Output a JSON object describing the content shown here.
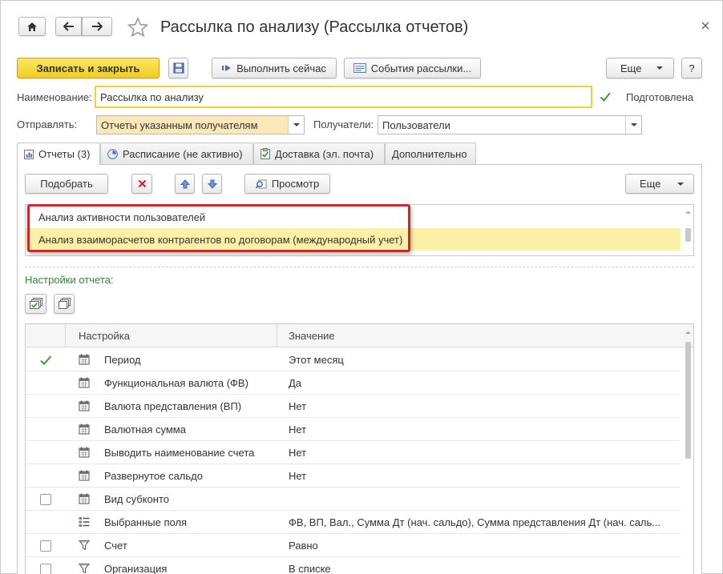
{
  "window": {
    "title": "Рассылка по анализу (Рассылка отчетов)"
  },
  "toolbar": {
    "save_close": "Записать и закрыть",
    "run_now": "Выполнить сейчас",
    "events": "События рассылки...",
    "more": "Еще",
    "help": "?"
  },
  "form": {
    "name_label": "Наименование:",
    "name_value": "Рассылка по анализу",
    "prepared_label": "Подготовлена",
    "prepared_checked": true,
    "send_label": "Отправлять:",
    "send_value": "Отчеты указанным получателям",
    "recipients_label": "Получатели:",
    "recipients_value": "Пользователи"
  },
  "tabs": [
    {
      "label": "Отчеты (3)",
      "active": true
    },
    {
      "label": "Расписание (не активно)",
      "active": false
    },
    {
      "label": "Доставка (эл. почта)",
      "active": false
    },
    {
      "label": "Дополнительно",
      "active": false
    }
  ],
  "reports_toolbar": {
    "pick": "Подобрать",
    "preview": "Просмотр",
    "more": "Еще"
  },
  "reports": [
    {
      "name": "Анализ активности пользователей",
      "selected": false
    },
    {
      "name": "Анализ взаиморасчетов контрагентов по договорам (международный учет)",
      "selected": true
    }
  ],
  "settings": {
    "title": "Настройки отчета:",
    "columns": {
      "setting": "Настройка",
      "value": "Значение"
    },
    "rows": [
      {
        "check": "checked",
        "icon": "calendar-icon",
        "name": "Период",
        "value": "Этот месяц"
      },
      {
        "check": "none",
        "icon": "calendar-icon",
        "name": "Функциональная валюта (ФВ)",
        "value": "Да"
      },
      {
        "check": "none",
        "icon": "calendar-icon",
        "name": "Валюта представления (ВП)",
        "value": "Нет"
      },
      {
        "check": "none",
        "icon": "calendar-icon",
        "name": "Валютная сумма",
        "value": "Нет"
      },
      {
        "check": "none",
        "icon": "calendar-icon",
        "name": "Выводить наименование счета",
        "value": "Нет"
      },
      {
        "check": "none",
        "icon": "calendar-icon",
        "name": "Развернутое сальдо",
        "value": "Нет"
      },
      {
        "check": "unchecked",
        "icon": "calendar-icon",
        "name": "Вид субконто",
        "value": ""
      },
      {
        "check": "none",
        "icon": "fields-list-icon",
        "name": "Выбранные поля",
        "value": "ФВ, ВП, Вал., Сумма Дт (нач. сальдо), Сумма представления Дт (нач. саль..."
      },
      {
        "check": "unchecked",
        "icon": "filter-icon",
        "name": "Счет",
        "value": "Равно"
      },
      {
        "check": "unchecked",
        "icon": "filter-icon",
        "name": "Организация",
        "value": "В списке"
      }
    ]
  },
  "colors": {
    "accent_yellow": "#f3cc1e",
    "selection": "#fbf0a6",
    "highlight_red": "#d3242c",
    "check_green": "#3a9a3a",
    "settings_green": "#2e8b2e"
  }
}
